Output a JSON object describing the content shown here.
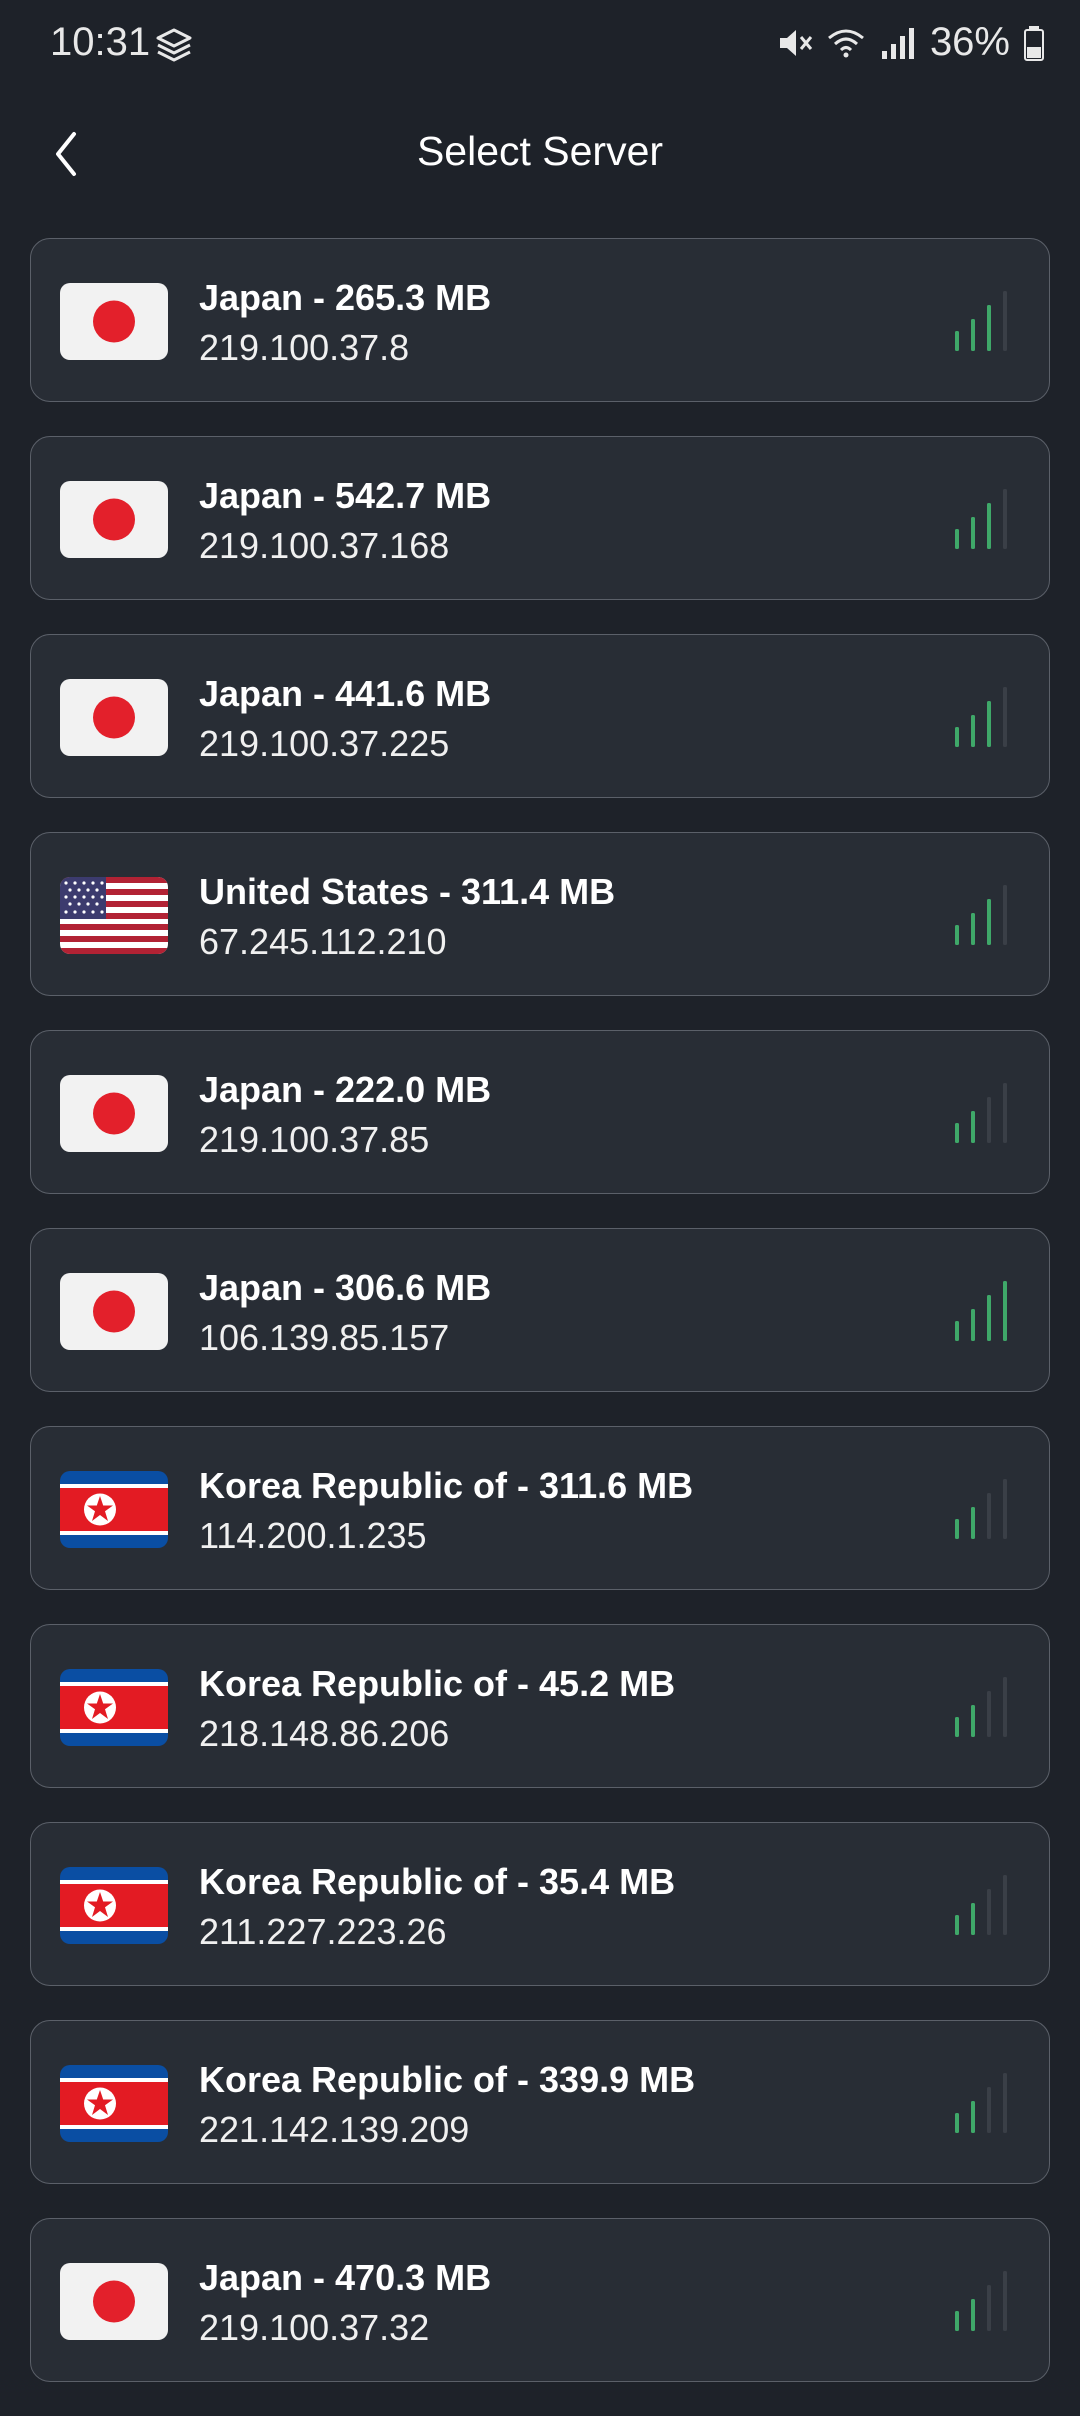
{
  "status": {
    "time": "10:31",
    "battery": "36%"
  },
  "header": {
    "title": "Select Server"
  },
  "colors": {
    "background": "#1e2229",
    "card": "#282d35",
    "signal_active": "#3fa869",
    "signal_inactive": "#3a3f47"
  },
  "servers": [
    {
      "label": "Japan - 265.3 MB",
      "ip": "219.100.37.8",
      "flag": "japan-flag-icon",
      "signal": 3
    },
    {
      "label": "Japan - 542.7 MB",
      "ip": "219.100.37.168",
      "flag": "japan-flag-icon",
      "signal": 3
    },
    {
      "label": "Japan - 441.6 MB",
      "ip": "219.100.37.225",
      "flag": "japan-flag-icon",
      "signal": 3
    },
    {
      "label": "United States - 311.4 MB",
      "ip": "67.245.112.210",
      "flag": "us-flag-icon",
      "signal": 3
    },
    {
      "label": "Japan - 222.0 MB",
      "ip": "219.100.37.85",
      "flag": "japan-flag-icon",
      "signal": 2
    },
    {
      "label": "Japan - 306.6 MB",
      "ip": "106.139.85.157",
      "flag": "japan-flag-icon",
      "signal": 4
    },
    {
      "label": "Korea Republic of - 311.6 MB",
      "ip": "114.200.1.235",
      "flag": "korea-flag-icon",
      "signal": 2
    },
    {
      "label": "Korea Republic of - 45.2 MB",
      "ip": "218.148.86.206",
      "flag": "korea-flag-icon",
      "signal": 2
    },
    {
      "label": "Korea Republic of - 35.4 MB",
      "ip": "211.227.223.26",
      "flag": "korea-flag-icon",
      "signal": 2
    },
    {
      "label": "Korea Republic of - 339.9 MB",
      "ip": "221.142.139.209",
      "flag": "korea-flag-icon",
      "signal": 2
    },
    {
      "label": "Japan - 470.3 MB",
      "ip": "219.100.37.32",
      "flag": "japan-flag-icon",
      "signal": 2
    }
  ]
}
